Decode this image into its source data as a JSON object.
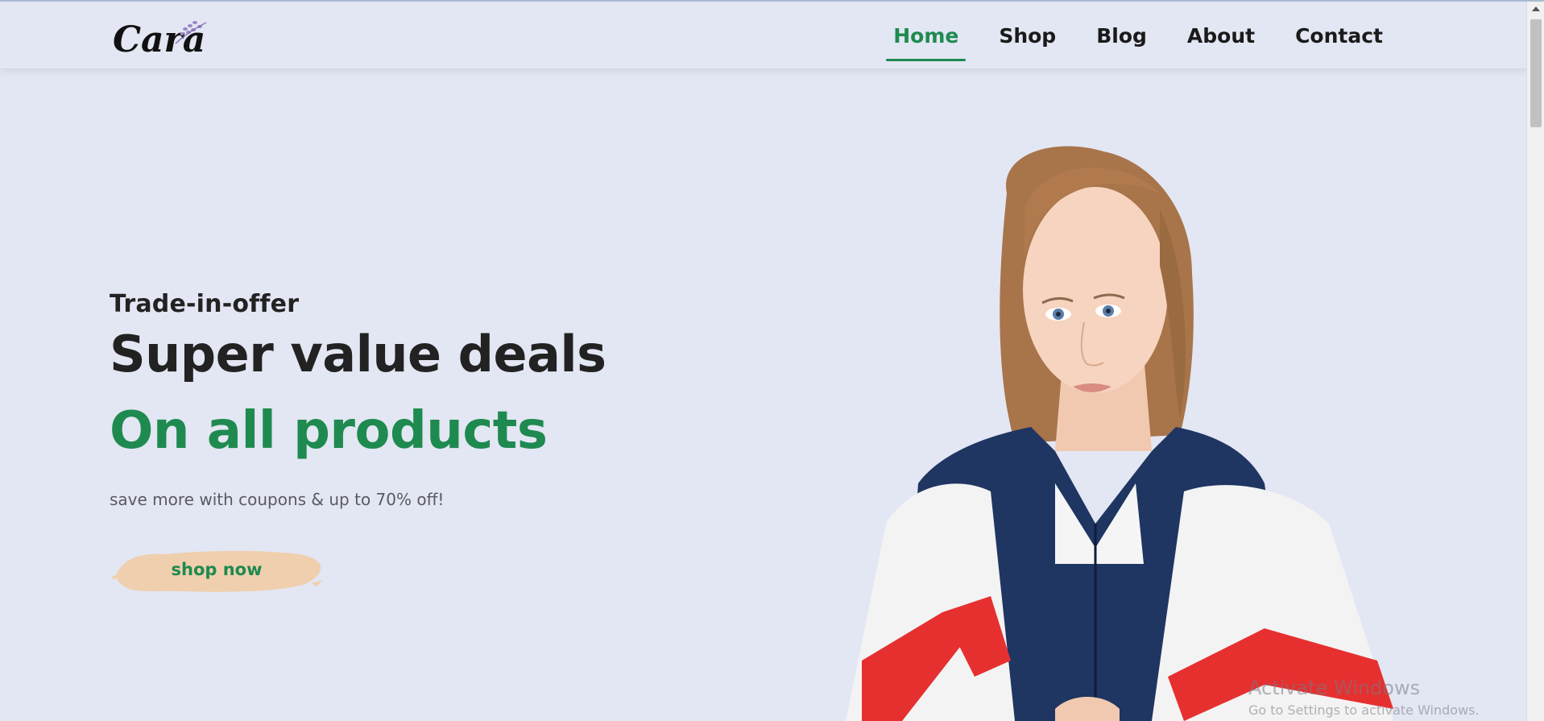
{
  "brand": {
    "logo_text": "Cara",
    "accent": "#1e8a4f",
    "background": "#e3e6f3",
    "button_color": "#f0cfae"
  },
  "nav": {
    "items": [
      {
        "label": "Home",
        "active": true
      },
      {
        "label": "Shop",
        "active": false
      },
      {
        "label": "Blog",
        "active": false
      },
      {
        "label": "About",
        "active": false
      },
      {
        "label": "Contact",
        "active": false
      }
    ]
  },
  "hero": {
    "eyebrow": "Trade-in-offer",
    "headline": "Super value deals",
    "highlight": "On all products",
    "subtext": "save more with coupons & up to 70% off!",
    "cta_label": "shop now"
  },
  "watermark": {
    "title": "Activate Windows",
    "subtitle": "Go to Settings to activate Windows."
  }
}
